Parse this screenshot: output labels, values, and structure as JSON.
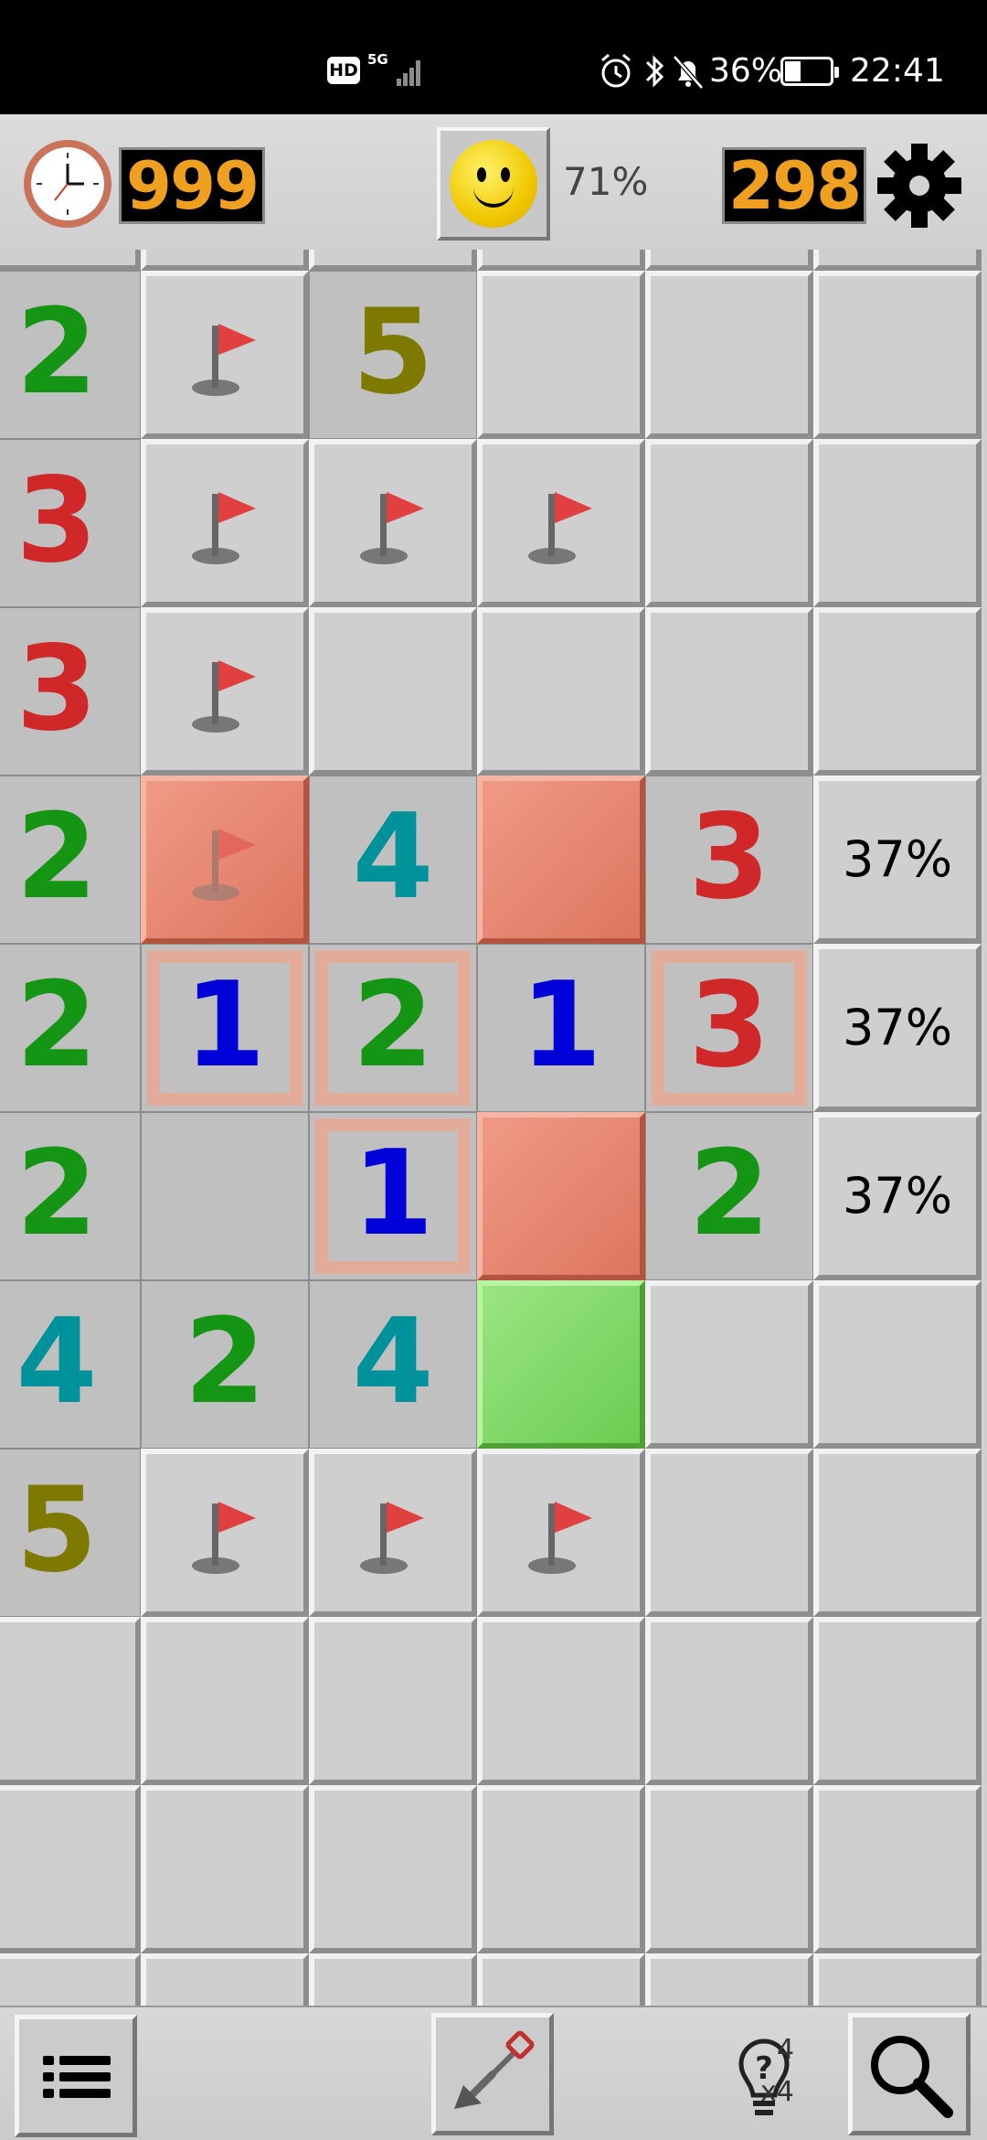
{
  "status_bar": {
    "hd": "HD",
    "network": "5G",
    "battery_percent": "36%",
    "battery_level": 0.36,
    "time": "22:41",
    "icons": [
      "alarm-icon",
      "bluetooth-icon",
      "mute-icon",
      "battery-charging-icon"
    ]
  },
  "header": {
    "timer_value": "999",
    "win_chance": "71%",
    "mines_left": "298",
    "icons": [
      "clock-icon",
      "smiley-icon",
      "gear-icon"
    ]
  },
  "board": {
    "rows": [
      [
        {
          "t": "open",
          "v": "2"
        },
        {
          "t": "flag"
        },
        {
          "t": "open",
          "v": "5"
        },
        {
          "t": "covered"
        },
        {
          "t": "covered"
        },
        {
          "t": "covered"
        }
      ],
      [
        {
          "t": "open",
          "v": "3"
        },
        {
          "t": "flag"
        },
        {
          "t": "flag"
        },
        {
          "t": "flag"
        },
        {
          "t": "covered"
        },
        {
          "t": "covered"
        }
      ],
      [
        {
          "t": "open",
          "v": "3"
        },
        {
          "t": "flag"
        },
        {
          "t": "covered"
        },
        {
          "t": "covered"
        },
        {
          "t": "covered"
        },
        {
          "t": "covered"
        }
      ],
      [
        {
          "t": "open",
          "v": "2"
        },
        {
          "t": "red-flag"
        },
        {
          "t": "open",
          "v": "4"
        },
        {
          "t": "red"
        },
        {
          "t": "open",
          "v": "3"
        },
        {
          "t": "prob",
          "v": "37%"
        }
      ],
      [
        {
          "t": "open",
          "v": "2"
        },
        {
          "t": "hl",
          "v": "1"
        },
        {
          "t": "hl",
          "v": "2"
        },
        {
          "t": "open",
          "v": "1"
        },
        {
          "t": "hl",
          "v": "3"
        },
        {
          "t": "prob",
          "v": "37%"
        }
      ],
      [
        {
          "t": "open",
          "v": "2"
        },
        {
          "t": "open",
          "v": ""
        },
        {
          "t": "hl",
          "v": "1"
        },
        {
          "t": "red"
        },
        {
          "t": "open",
          "v": "2"
        },
        {
          "t": "prob",
          "v": "37%"
        }
      ],
      [
        {
          "t": "open",
          "v": "4"
        },
        {
          "t": "open",
          "v": "2"
        },
        {
          "t": "open",
          "v": "4"
        },
        {
          "t": "green"
        },
        {
          "t": "covered"
        },
        {
          "t": "covered"
        }
      ],
      [
        {
          "t": "open",
          "v": "5"
        },
        {
          "t": "flag"
        },
        {
          "t": "flag"
        },
        {
          "t": "flag"
        },
        {
          "t": "covered"
        },
        {
          "t": "covered"
        }
      ],
      [
        {
          "t": "covered"
        },
        {
          "t": "covered"
        },
        {
          "t": "covered"
        },
        {
          "t": "covered"
        },
        {
          "t": "covered"
        },
        {
          "t": "covered"
        }
      ],
      [
        {
          "t": "covered"
        },
        {
          "t": "covered"
        },
        {
          "t": "covered"
        },
        {
          "t": "covered"
        },
        {
          "t": "covered"
        },
        {
          "t": "covered"
        }
      ],
      [
        {
          "t": "covered"
        },
        {
          "t": "covered"
        },
        {
          "t": "covered"
        },
        {
          "t": "covered"
        },
        {
          "t": "covered"
        },
        {
          "t": "covered"
        }
      ]
    ],
    "colors": {
      "1": "#0000d8",
      "2": "#149614",
      "3": "#d02828",
      "4": "#00929a",
      "5": "#7e7a00"
    }
  },
  "bottom_bar": {
    "hint_count": "4",
    "hint_multiplier": "x4",
    "icons": [
      "menu-icon",
      "shovel-icon",
      "hint-bulb-icon",
      "zoom-icon"
    ]
  }
}
